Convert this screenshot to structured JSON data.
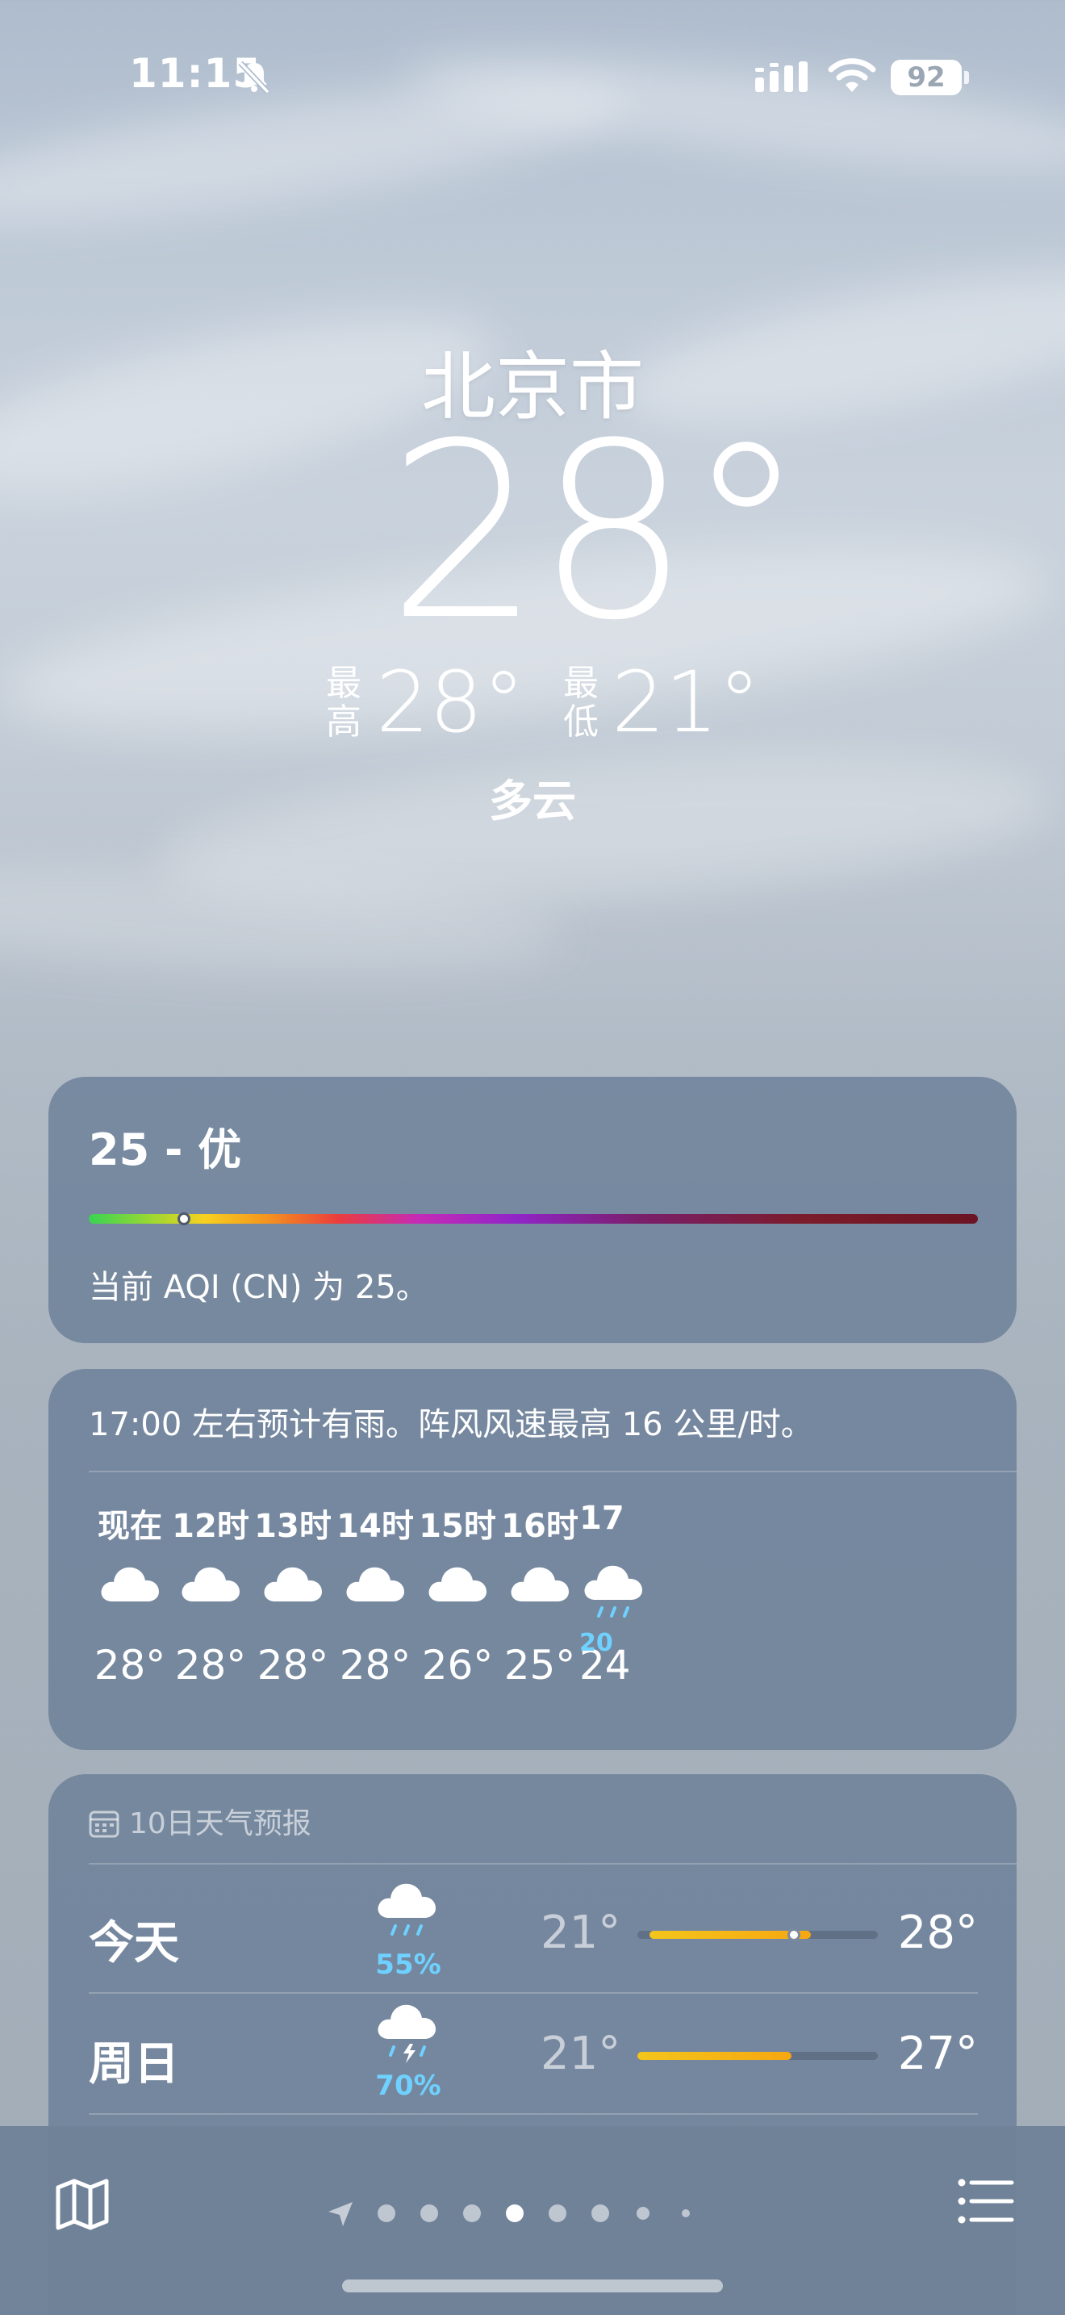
{
  "status_bar": {
    "time": "11:15",
    "battery": "92"
  },
  "location": {
    "city": "北京市",
    "current_temp": "28°",
    "high_label": "最高",
    "high": "28°",
    "low_label": "最低",
    "low": "21°",
    "condition": "多云"
  },
  "aqi": {
    "value_text": "25 - 优",
    "description": "当前 AQI (CN) 为 25。",
    "level": 25
  },
  "hourly": {
    "summary": "17:00 左右预计有雨。阵风风速最高 16 公里/时。",
    "items": [
      {
        "label": "现在",
        "icon": "cloud-icon",
        "temp": "28°",
        "pop": ""
      },
      {
        "label": "12时",
        "icon": "cloud-icon",
        "temp": "28°",
        "pop": ""
      },
      {
        "label": "13时",
        "icon": "cloud-icon",
        "temp": "28°",
        "pop": ""
      },
      {
        "label": "14时",
        "icon": "cloud-icon",
        "temp": "28°",
        "pop": ""
      },
      {
        "label": "15时",
        "icon": "cloud-icon",
        "temp": "26°",
        "pop": ""
      },
      {
        "label": "16时",
        "icon": "cloud-icon",
        "temp": "25°",
        "pop": ""
      },
      {
        "label": "17",
        "icon": "rain-cloud-icon",
        "temp": "24",
        "pop": "20"
      }
    ]
  },
  "daily": {
    "header": "10日天气预报",
    "items": [
      {
        "day": "今天",
        "icon": "rain-cloud-icon",
        "pop": "55%",
        "low": "21°",
        "high": "28°",
        "bar_start": 0.05,
        "bar_end": 0.72,
        "now_pos": 0.65
      },
      {
        "day": "周日",
        "icon": "thunderstorm-icon",
        "pop": "70%",
        "low": "21°",
        "high": "27°",
        "bar_start": 0.0,
        "bar_end": 0.64
      }
    ]
  },
  "bottom_bar": {
    "page_count": 9,
    "active_page": 4
  },
  "colors": {
    "pop": "#6fd1ff",
    "card": "#687c96",
    "bar_warm": "#f3c51b"
  }
}
